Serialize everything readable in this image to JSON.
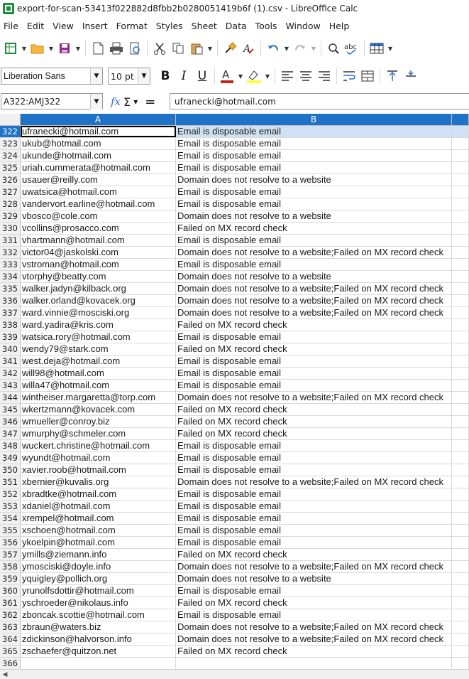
{
  "window": {
    "title": "export-for-scan-53413f022882d8fbb2b0280051419b6f (1).csv - LibreOffice Calc"
  },
  "menu": [
    "File",
    "Edit",
    "View",
    "Insert",
    "Format",
    "Styles",
    "Sheet",
    "Data",
    "Tools",
    "Window",
    "Help"
  ],
  "format": {
    "font_name": "Liberation Sans",
    "font_size": "10 pt"
  },
  "formula_bar": {
    "name_box": "A322:AMJ322",
    "content": "ufranecki@hotmail.com"
  },
  "columns": [
    "A",
    "B"
  ],
  "colors": {
    "accent": "#1e73c8",
    "selection": "#cfe2f3"
  },
  "rows": [
    {
      "num": "322",
      "a": "ufranecki@hotmail.com",
      "b": "Email is disposable email"
    },
    {
      "num": "323",
      "a": "ukub@hotmail.com",
      "b": "Email is disposable email"
    },
    {
      "num": "324",
      "a": "ukunde@hotmail.com",
      "b": "Email is disposable email"
    },
    {
      "num": "325",
      "a": "uriah.cummerata@hotmail.com",
      "b": "Email is disposable email"
    },
    {
      "num": "326",
      "a": "usauer@reilly.com",
      "b": "Domain does not resolve to a website"
    },
    {
      "num": "327",
      "a": "uwatsica@hotmail.com",
      "b": "Email is disposable email"
    },
    {
      "num": "328",
      "a": "vandervort.earline@hotmail.com",
      "b": "Email is disposable email"
    },
    {
      "num": "329",
      "a": "vbosco@cole.com",
      "b": "Domain does not resolve to a website"
    },
    {
      "num": "330",
      "a": "vcollins@prosacco.com",
      "b": "Failed on MX record check"
    },
    {
      "num": "331",
      "a": "vhartmann@hotmail.com",
      "b": "Email is disposable email"
    },
    {
      "num": "332",
      "a": "victor04@jaskolski.com",
      "b": "Domain does not resolve to a website;Failed on MX record check"
    },
    {
      "num": "333",
      "a": "vstroman@hotmail.com",
      "b": "Email is disposable email"
    },
    {
      "num": "334",
      "a": "vtorphy@beatty.com",
      "b": "Domain does not resolve to a website"
    },
    {
      "num": "335",
      "a": "walker.jadyn@kilback.org",
      "b": "Domain does not resolve to a website;Failed on MX record check"
    },
    {
      "num": "336",
      "a": "walker.orland@kovacek.org",
      "b": "Domain does not resolve to a website;Failed on MX record check"
    },
    {
      "num": "337",
      "a": "ward.vinnie@mosciski.org",
      "b": "Domain does not resolve to a website;Failed on MX record check"
    },
    {
      "num": "338",
      "a": "ward.yadira@kris.com",
      "b": "Failed on MX record check"
    },
    {
      "num": "339",
      "a": "watsica.rory@hotmail.com",
      "b": "Email is disposable email"
    },
    {
      "num": "340",
      "a": "wendy79@stark.com",
      "b": "Failed on MX record check"
    },
    {
      "num": "341",
      "a": "west.deja@hotmail.com",
      "b": "Email is disposable email"
    },
    {
      "num": "342",
      "a": "will98@hotmail.com",
      "b": "Email is disposable email"
    },
    {
      "num": "343",
      "a": "willa47@hotmail.com",
      "b": "Email is disposable email"
    },
    {
      "num": "344",
      "a": "wintheiser.margaretta@torp.com",
      "b": "Domain does not resolve to a website;Failed on MX record check"
    },
    {
      "num": "345",
      "a": "wkertzmann@kovacek.com",
      "b": "Failed on MX record check"
    },
    {
      "num": "346",
      "a": "wmueller@conroy.biz",
      "b": "Failed on MX record check"
    },
    {
      "num": "347",
      "a": "wmurphy@schmeler.com",
      "b": "Failed on MX record check"
    },
    {
      "num": "348",
      "a": "wuckert.christine@hotmail.com",
      "b": "Email is disposable email"
    },
    {
      "num": "349",
      "a": "wyundt@hotmail.com",
      "b": "Email is disposable email"
    },
    {
      "num": "350",
      "a": "xavier.roob@hotmail.com",
      "b": "Email is disposable email"
    },
    {
      "num": "351",
      "a": "xbernier@kuvalis.org",
      "b": "Domain does not resolve to a website;Failed on MX record check"
    },
    {
      "num": "352",
      "a": "xbradtke@hotmail.com",
      "b": "Email is disposable email"
    },
    {
      "num": "353",
      "a": "xdaniel@hotmail.com",
      "b": "Email is disposable email"
    },
    {
      "num": "354",
      "a": "xrempel@hotmail.com",
      "b": "Email is disposable email"
    },
    {
      "num": "355",
      "a": "xschoen@hotmail.com",
      "b": "Email is disposable email"
    },
    {
      "num": "356",
      "a": "ykoelpin@hotmail.com",
      "b": "Email is disposable email"
    },
    {
      "num": "357",
      "a": "ymills@ziemann.info",
      "b": "Failed on MX record check"
    },
    {
      "num": "358",
      "a": "ymosciski@doyle.info",
      "b": "Domain does not resolve to a website;Failed on MX record check"
    },
    {
      "num": "359",
      "a": "yquigley@pollich.org",
      "b": "Domain does not resolve to a website"
    },
    {
      "num": "360",
      "a": "yrunolfsdottir@hotmail.com",
      "b": "Email is disposable email"
    },
    {
      "num": "361",
      "a": "yschroeder@nikolaus.info",
      "b": "Failed on MX record check"
    },
    {
      "num": "362",
      "a": "zboncak.scottie@hotmail.com",
      "b": "Email is disposable email"
    },
    {
      "num": "363",
      "a": "zbraun@waters.biz",
      "b": "Domain does not resolve to a website;Failed on MX record check"
    },
    {
      "num": "364",
      "a": "zdickinson@halvorson.info",
      "b": "Domain does not resolve to a website;Failed on MX record check"
    },
    {
      "num": "365",
      "a": "zschaefer@quitzon.net",
      "b": "Failed on MX record check"
    },
    {
      "num": "366",
      "a": "",
      "b": ""
    }
  ]
}
